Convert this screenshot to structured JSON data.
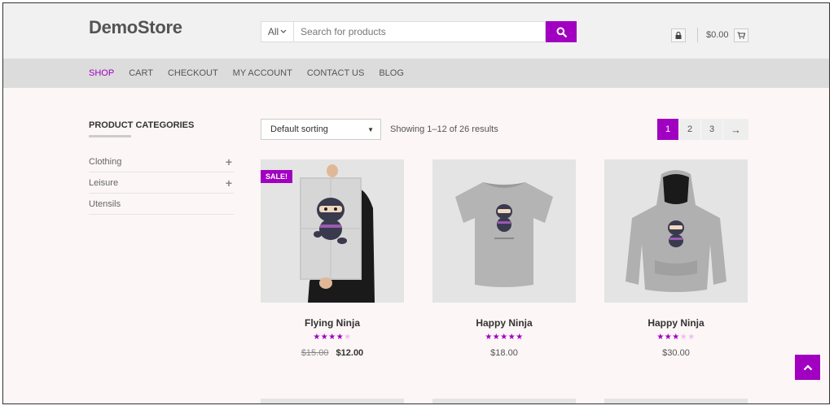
{
  "header": {
    "logo": "DemoStore",
    "search": {
      "category": "All",
      "placeholder": "Search for products"
    },
    "cart_total": "$0.00"
  },
  "nav": {
    "items": [
      {
        "label": "SHOP",
        "active": true
      },
      {
        "label": "CART",
        "active": false
      },
      {
        "label": "CHECKOUT",
        "active": false
      },
      {
        "label": "MY ACCOUNT",
        "active": false
      },
      {
        "label": "CONTACT US",
        "active": false
      },
      {
        "label": "BLOG",
        "active": false
      }
    ]
  },
  "sidebar": {
    "title": "PRODUCT CATEGORIES",
    "categories": [
      {
        "label": "Clothing",
        "expandable": true
      },
      {
        "label": "Leisure",
        "expandable": true
      },
      {
        "label": "Utensils",
        "expandable": false
      }
    ]
  },
  "toolbar": {
    "sort_selected": "Default sorting",
    "result_count": "Showing 1–12 of 26 results",
    "pages": [
      "1",
      "2",
      "3"
    ],
    "current_page": "1",
    "next_label": "→"
  },
  "products": [
    {
      "name": "Flying Ninja",
      "sale_badge": "SALE!",
      "rating": 4,
      "rating_max": 5,
      "old_price": "$15.00",
      "price": "$12.00",
      "image": "ninja-poster"
    },
    {
      "name": "Happy Ninja",
      "sale_badge": "",
      "rating": 5,
      "rating_max": 5,
      "old_price": "",
      "price": "$18.00",
      "image": "ninja-tshirt"
    },
    {
      "name": "Happy Ninja",
      "sale_badge": "",
      "rating": 3,
      "rating_max": 5,
      "old_price": "",
      "price": "$30.00",
      "image": "ninja-hoodie"
    }
  ],
  "theme": {
    "accent": "#a100c1",
    "star_off": "#e8c0f0"
  },
  "icons": {
    "search": "search-icon",
    "lock": "lock-icon",
    "cart": "cart-icon",
    "back_to_top": "chevron-up-icon",
    "expand": "plus-icon"
  }
}
